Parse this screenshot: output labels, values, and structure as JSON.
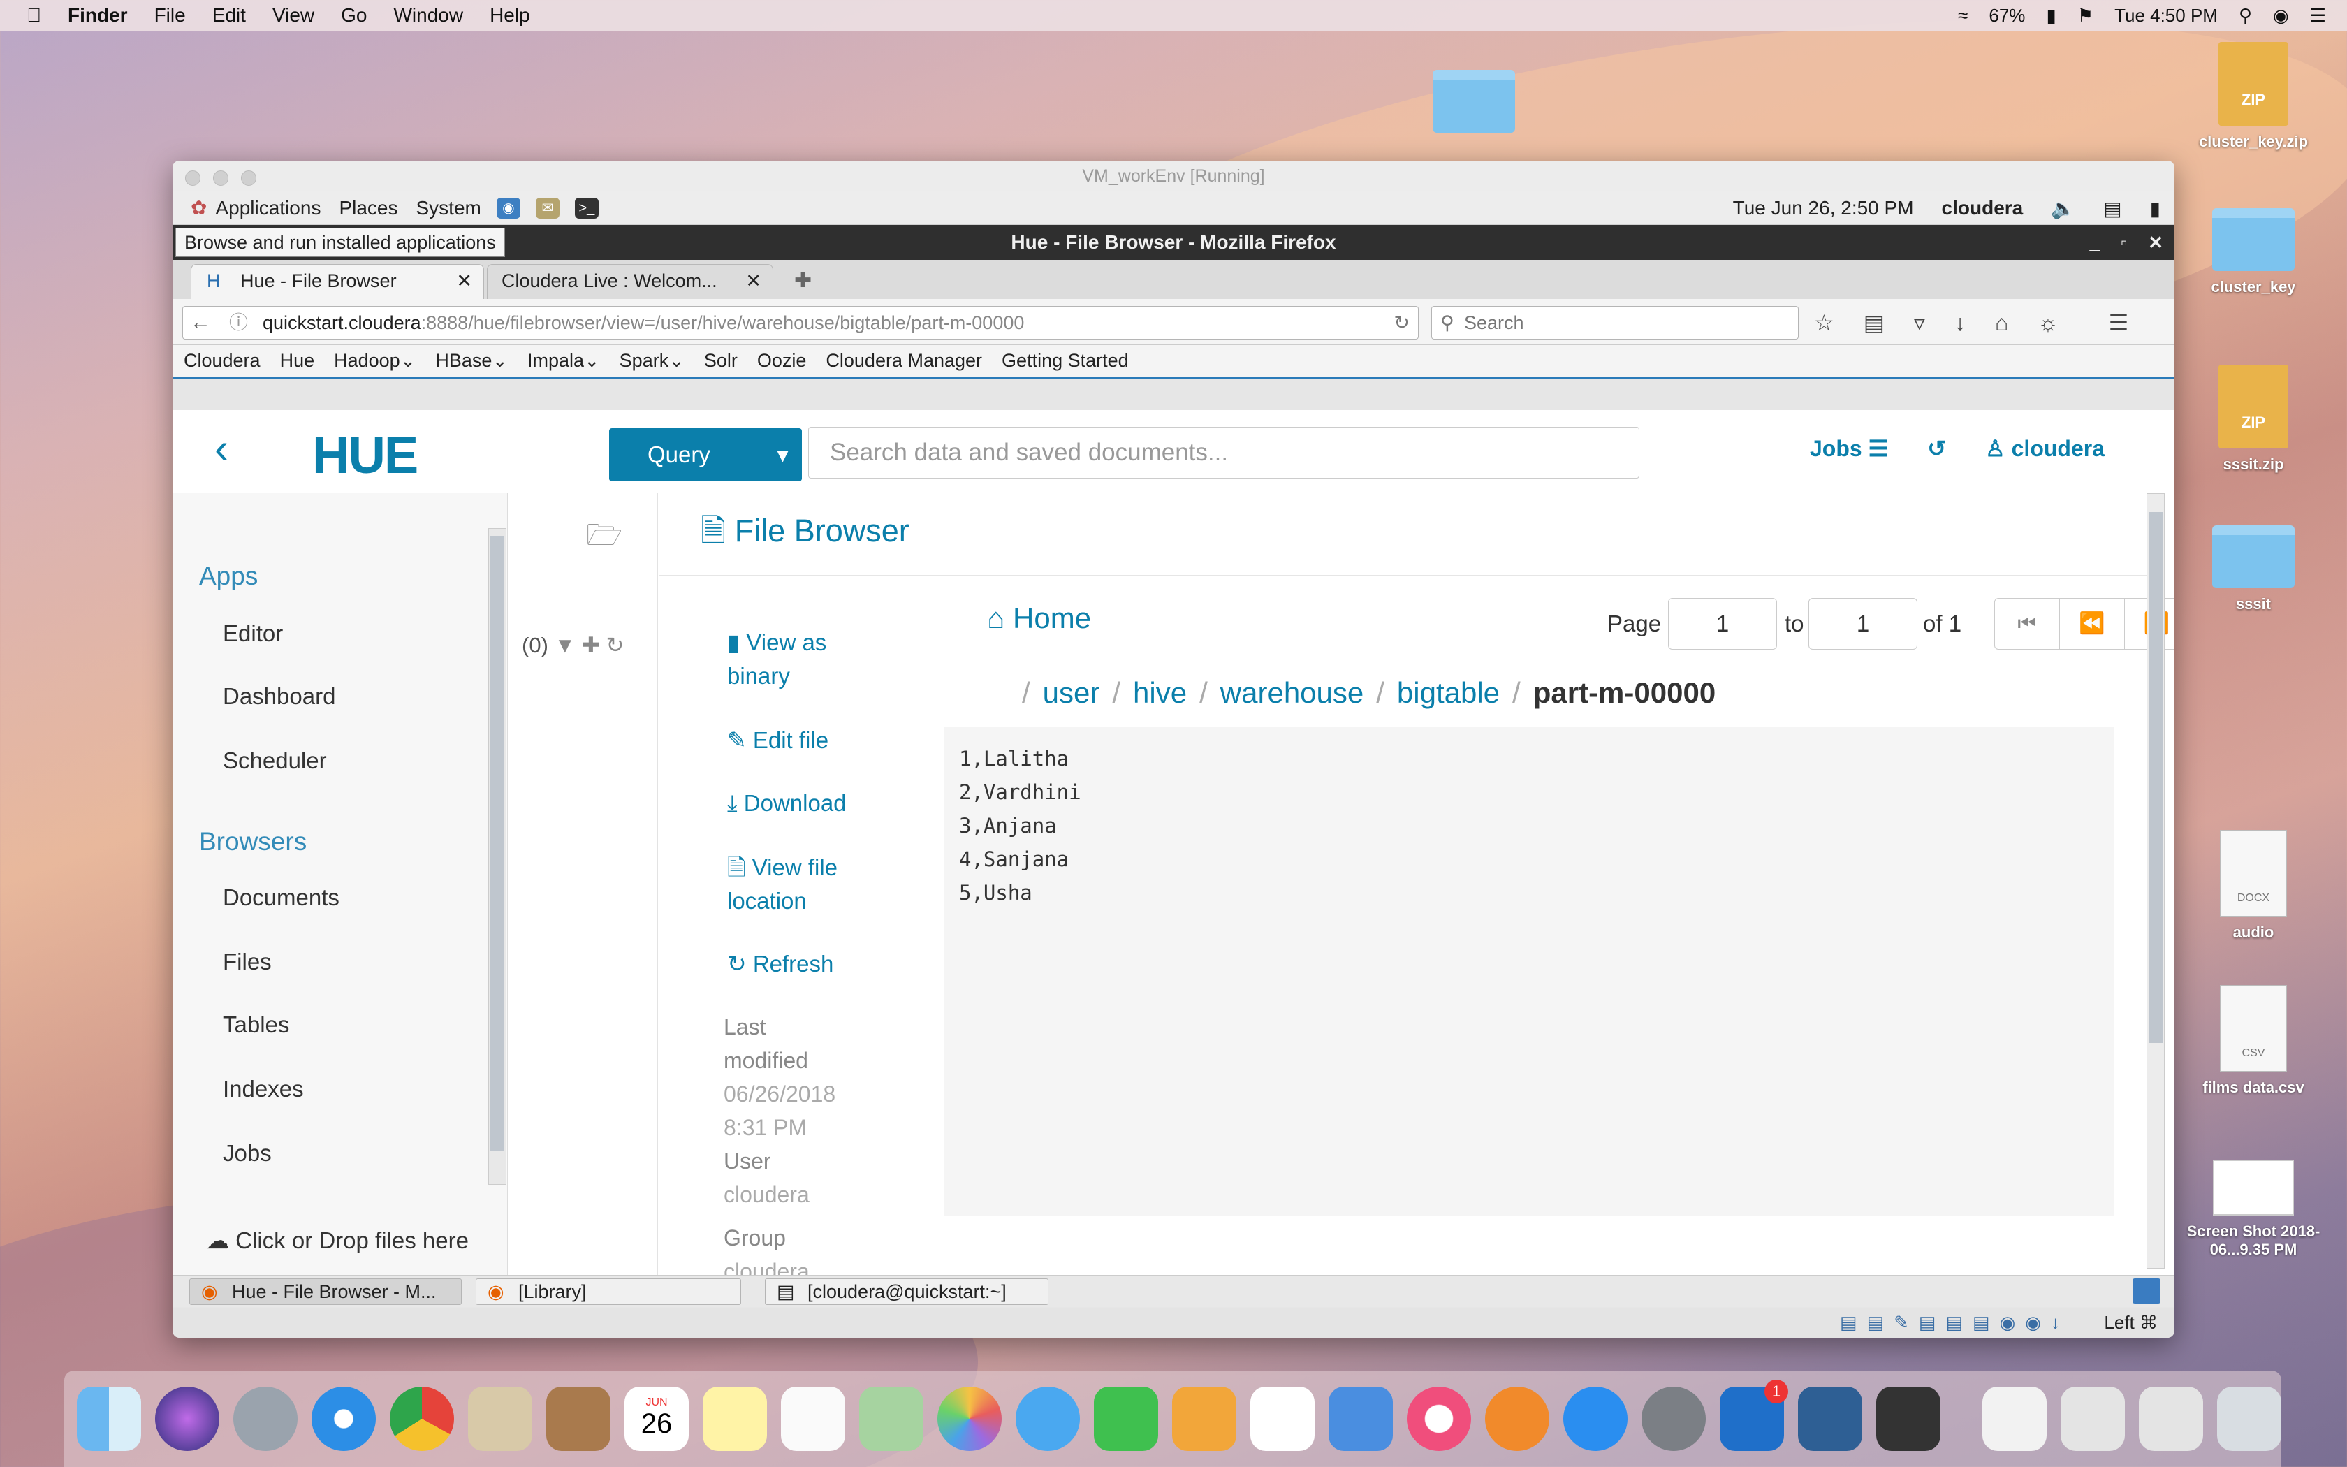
{
  "menubar": {
    "finder": "Finder",
    "items": [
      "File",
      "Edit",
      "View",
      "Go",
      "Window",
      "Help"
    ],
    "battery": "67%",
    "clock": "Tue 4:50 PM"
  },
  "desktop": {
    "icons": [
      {
        "label": "cluster_key.zip",
        "type": "zip",
        "badge": "ZIP"
      },
      {
        "label": "cluster_key",
        "type": "folder"
      },
      {
        "label": "sssit.zip",
        "type": "zip",
        "badge": "ZIP"
      },
      {
        "label": "sssit",
        "type": "folder"
      },
      {
        "label": "audio",
        "type": "docx",
        "badge": "DOCX"
      },
      {
        "label": "films data.csv",
        "type": "csv",
        "badge": "CSV"
      },
      {
        "label": "Screen Shot 2018-06...9.35 PM",
        "type": "screenshot"
      }
    ]
  },
  "vm": {
    "title": "VM_workEnv [Running]"
  },
  "gnome": {
    "applications": "Applications",
    "places": "Places",
    "system": "System",
    "datetime": "Tue Jun 26,  2:50 PM",
    "user": "cloudera"
  },
  "firefox": {
    "title": "Hue - File Browser - Mozilla Firefox",
    "tooltip": "Browse and run installed applications",
    "tabs": [
      {
        "label": "Hue - File Browser"
      },
      {
        "label": "Cloudera Live : Welcom..."
      }
    ],
    "url_host": "quickstart.cloudera",
    "url_path": ":8888/hue/filebrowser/view=/user/hive/warehouse/bigtable/part-m-00000",
    "search_placeholder": "Search",
    "bookmarks": [
      "Cloudera",
      "Hue",
      "Hadoop",
      "HBase",
      "Impala",
      "Spark",
      "Solr",
      "Oozie",
      "Cloudera Manager",
      "Getting Started"
    ]
  },
  "hue": {
    "logo": "HUE",
    "query": "Query",
    "search_placeholder": "Search data and saved documents...",
    "jobs": "Jobs",
    "user": "cloudera",
    "sidebar": {
      "apps_title": "Apps",
      "apps": [
        "Editor",
        "Dashboard",
        "Scheduler"
      ],
      "browsers_title": "Browsers",
      "browsers": [
        "Documents",
        "Files",
        "Tables",
        "Indexes",
        "Jobs"
      ],
      "drop": "Click or Drop files here"
    },
    "mid": {
      "count": "(0)"
    },
    "page_title": "File Browser",
    "actions": {
      "view_binary_1": "View as",
      "view_binary_2": "binary",
      "edit": "Edit file",
      "download": "Download",
      "view_loc_1": "View file",
      "view_loc_2": "location",
      "refresh": "Refresh"
    },
    "meta": {
      "last_mod_1": "Last",
      "last_mod_2": "modified",
      "date": "06/26/2018",
      "time": "8:31 PM",
      "user_label": "User",
      "user": "cloudera",
      "group_label": "Group",
      "group": "cloudera"
    },
    "home": "Home",
    "pager": {
      "page_label": "Page",
      "from": "1",
      "to_label": "to",
      "to": "1",
      "of": "of 1"
    },
    "breadcrumb": [
      "user",
      "hive",
      "warehouse",
      "bigtable"
    ],
    "breadcrumb_current": "part-m-00000",
    "file_lines": [
      "1,Lalitha",
      "2,Vardhini",
      "3,Anjana",
      "4,Sanjana",
      "5,Usha"
    ]
  },
  "taskbar": [
    {
      "label": "Hue - File Browser - M..."
    },
    {
      "label": "[Library]"
    },
    {
      "label": "[cloudera@quickstart:~]"
    }
  ],
  "status": {
    "hostkey": "Left ⌘"
  },
  "dock": {
    "calendar_month": "JUN",
    "calendar_day": "26",
    "outlook_badge": "1"
  }
}
